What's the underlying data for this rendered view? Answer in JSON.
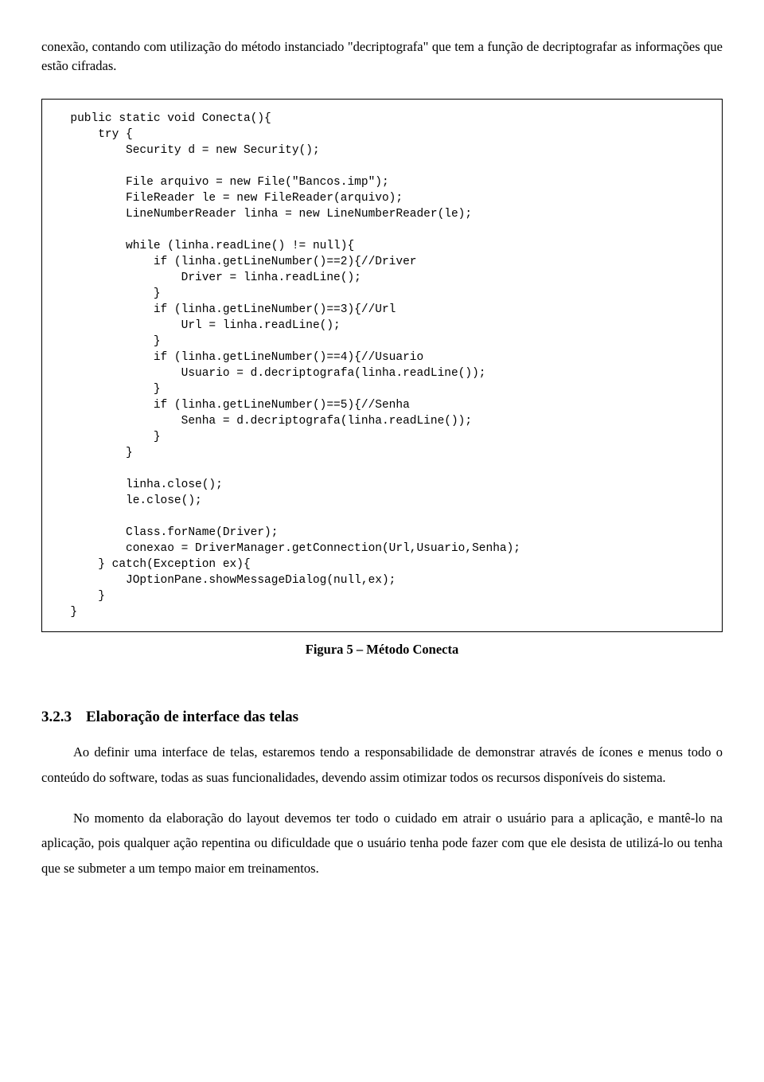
{
  "intro": "conexão, contando com utilização do método instanciado \"decriptografa\"  que tem a função de decriptografar as informações que estão cifradas.",
  "code": "  public static void Conecta(){\n      try {\n          Security d = new Security();\n\n          File arquivo = new File(\"Bancos.imp\");\n          FileReader le = new FileReader(arquivo);\n          LineNumberReader linha = new LineNumberReader(le);\n\n          while (linha.readLine() != null){\n              if (linha.getLineNumber()==2){//Driver\n                  Driver = linha.readLine();\n              }\n              if (linha.getLineNumber()==3){//Url\n                  Url = linha.readLine();\n              }\n              if (linha.getLineNumber()==4){//Usuario\n                  Usuario = d.decriptografa(linha.readLine());\n              }\n              if (linha.getLineNumber()==5){//Senha\n                  Senha = d.decriptografa(linha.readLine());\n              }\n          }\n\n          linha.close();\n          le.close();\n\n          Class.forName(Driver);\n          conexao = DriverManager.getConnection(Url,Usuario,Senha);\n      } catch(Exception ex){\n          JOptionPane.showMessageDialog(null,ex);\n      }\n  }",
  "caption": "Figura 5 – Método Conecta",
  "section": {
    "number": "3.2.3",
    "title": "Elaboração de interface das telas"
  },
  "para1": "Ao definir uma interface de telas, estaremos tendo a responsabilidade de demonstrar através de ícones e menus todo o conteúdo do software, todas as suas funcionalidades, devendo assim otimizar todos os recursos disponíveis do sistema.",
  "para2": "No momento da elaboração do layout devemos ter todo o cuidado em atrair o usuário para a aplicação, e mantê-lo na aplicação, pois qualquer ação repentina ou dificuldade que o usuário tenha pode fazer com que ele desista de utilizá-lo ou tenha que se submeter a um tempo maior em treinamentos."
}
